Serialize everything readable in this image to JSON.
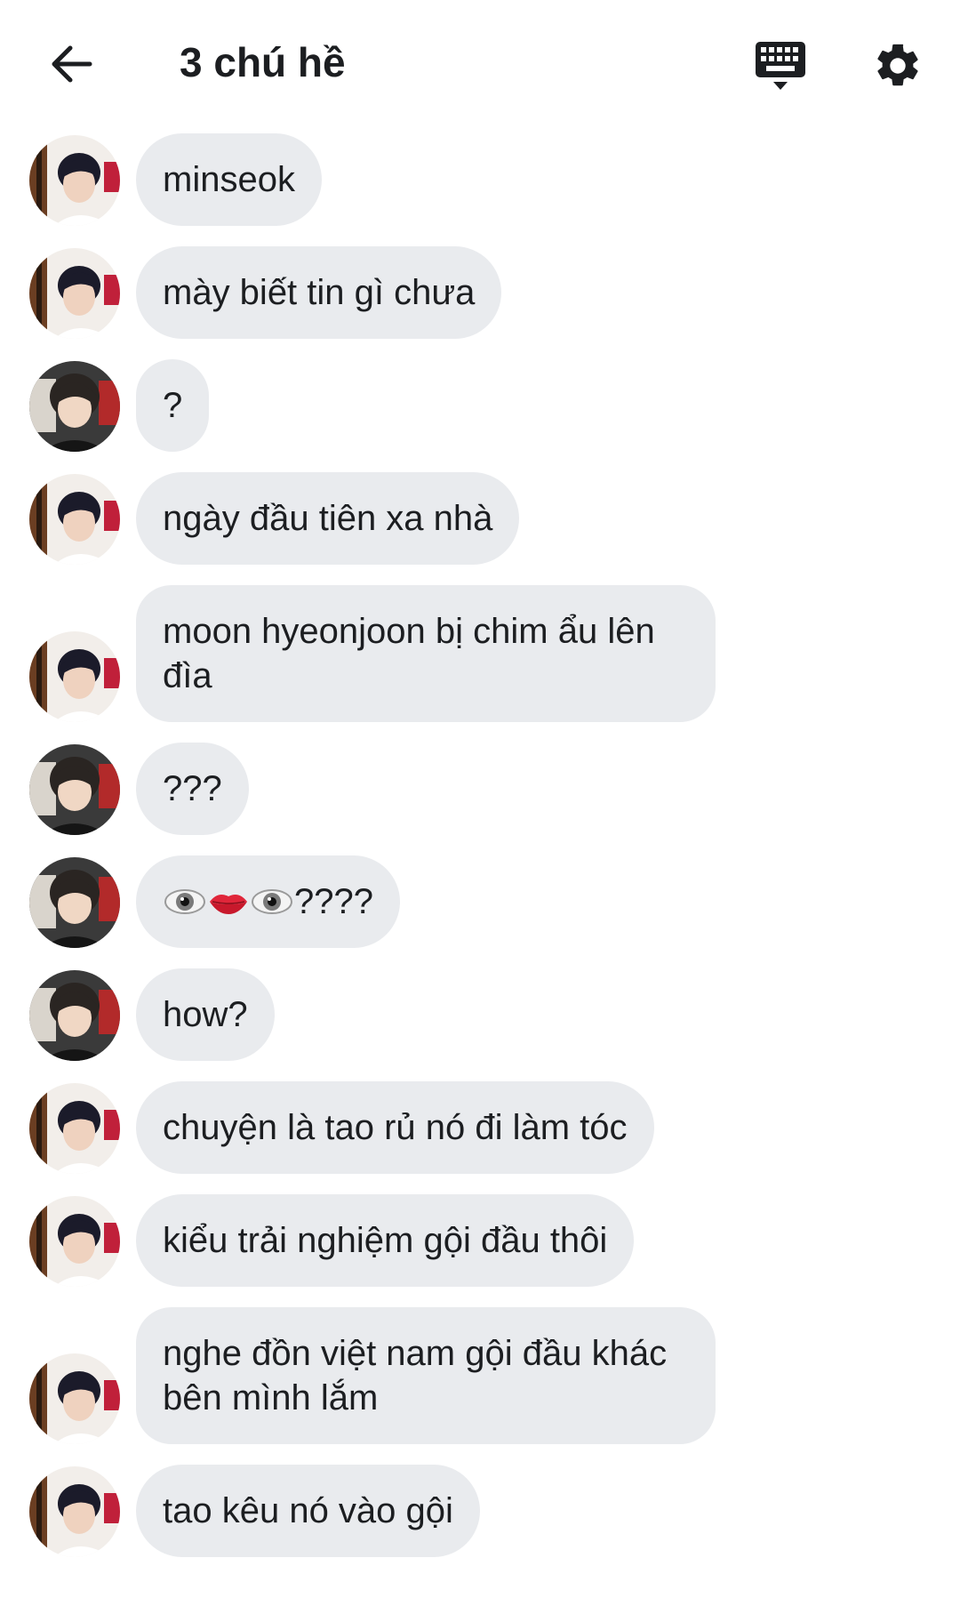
{
  "header": {
    "title": "3 chú hề",
    "back_icon": "arrow-left-icon",
    "keyboard_icon": "keyboard-icon",
    "settings_icon": "gear-icon"
  },
  "messages": [
    {
      "sender": "a",
      "text": "minseok"
    },
    {
      "sender": "a",
      "text": "mày biết tin gì chưa"
    },
    {
      "sender": "b",
      "text": "?"
    },
    {
      "sender": "a",
      "text": "ngày đầu tiên xa nhà"
    },
    {
      "sender": "a",
      "text": "moon hyeonjoon bị chim ẩu lên đìa"
    },
    {
      "sender": "b",
      "text": "???"
    },
    {
      "sender": "b",
      "text": "????",
      "emoji_prefix": [
        "eye",
        "lips",
        "eye"
      ]
    },
    {
      "sender": "b",
      "text": "how?"
    },
    {
      "sender": "a",
      "text": "chuyện là tao rủ nó đi làm tóc"
    },
    {
      "sender": "a",
      "text": "kiểu trải nghiệm gội đầu thôi"
    },
    {
      "sender": "a",
      "text": "nghe đồn việt nam gội đầu khác bên mình lắm"
    },
    {
      "sender": "a",
      "text": "tao kêu nó vào gội"
    }
  ],
  "colors": {
    "bubble": "#e9ebee",
    "text": "#1c1e21",
    "background": "#ffffff"
  }
}
